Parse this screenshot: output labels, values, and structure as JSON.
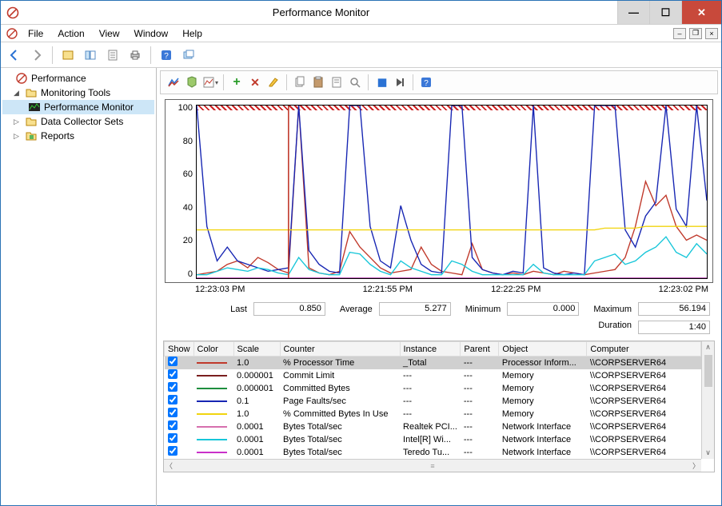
{
  "window": {
    "title": "Performance Monitor"
  },
  "menu": {
    "file": "File",
    "action": "Action",
    "view": "View",
    "window": "Window",
    "help": "Help"
  },
  "tree": {
    "root": "Performance",
    "monitoring": "Monitoring Tools",
    "perfmon": "Performance Monitor",
    "dcs": "Data Collector Sets",
    "reports": "Reports"
  },
  "chart_data": {
    "type": "line",
    "title": "",
    "ylabel": "",
    "xlabel": "",
    "ylim": [
      0,
      100
    ],
    "yticks": [
      0,
      20,
      40,
      60,
      80,
      100
    ],
    "xticks": [
      "12:23:03 PM",
      "12:21:55 PM",
      "12:22:25 PM",
      "12:23:02 PM"
    ],
    "series": [
      {
        "name": "% Processor Time",
        "color": "#c0392b",
        "values": [
          2,
          3,
          4,
          8,
          10,
          6,
          12,
          9,
          5,
          3,
          100,
          6,
          3,
          2,
          4,
          27,
          18,
          12,
          6,
          3,
          4,
          5,
          18,
          8,
          4,
          3,
          2,
          20,
          5,
          3,
          2,
          3,
          2,
          4,
          3,
          2,
          4,
          3,
          2,
          3,
          4,
          5,
          12,
          30,
          56,
          42,
          48,
          30,
          22,
          25,
          22
        ]
      },
      {
        "name": "Page Faults/sec (scaled)",
        "color": "#1726b3",
        "values": [
          100,
          30,
          10,
          18,
          10,
          8,
          6,
          4,
          5,
          6,
          100,
          16,
          8,
          4,
          3,
          100,
          100,
          30,
          10,
          6,
          42,
          22,
          8,
          4,
          3,
          100,
          100,
          12,
          5,
          3,
          2,
          4,
          3,
          100,
          6,
          3,
          2,
          3,
          2,
          100,
          100,
          100,
          28,
          18,
          36,
          44,
          100,
          40,
          30,
          100,
          45
        ]
      },
      {
        "name": "% Committed Bytes In Use",
        "color": "#f1d40f",
        "values": [
          28,
          28,
          28,
          28,
          28,
          28,
          28,
          28,
          28,
          28,
          28,
          28,
          28,
          28,
          28,
          28,
          28,
          28,
          28,
          28,
          28,
          28,
          28,
          28,
          28,
          28,
          28,
          28,
          28,
          28,
          28,
          28,
          28,
          28,
          28,
          28,
          28,
          28,
          28,
          28,
          29,
          29,
          29,
          29,
          30,
          30,
          30,
          30,
          30,
          30,
          30
        ]
      },
      {
        "name": "Bytes Total/sec Intel",
        "color": "#17c6d9",
        "values": [
          2,
          2,
          4,
          6,
          5,
          4,
          6,
          5,
          3,
          2,
          12,
          5,
          3,
          2,
          2,
          15,
          14,
          8,
          4,
          2,
          10,
          6,
          4,
          2,
          2,
          10,
          8,
          4,
          2,
          2,
          2,
          2,
          2,
          8,
          3,
          2,
          2,
          2,
          2,
          10,
          12,
          14,
          8,
          10,
          15,
          18,
          24,
          15,
          12,
          20,
          14
        ]
      },
      {
        "name": "Commit Limit",
        "color": "#7a1f1f",
        "values": [
          0,
          0,
          0,
          0,
          0,
          0,
          0,
          0,
          0,
          0,
          0,
          0,
          0,
          0,
          0,
          0,
          0,
          0,
          0,
          0,
          0,
          0,
          0,
          0,
          0,
          0,
          0,
          0,
          0,
          0,
          0,
          0,
          0,
          0,
          0,
          0,
          0,
          0,
          0,
          0,
          0,
          0,
          0,
          0,
          0,
          0,
          0,
          0,
          0,
          0,
          0
        ]
      },
      {
        "name": "Committed Bytes",
        "color": "#1e8e3e",
        "values": [
          0,
          0,
          0,
          0,
          0,
          0,
          0,
          0,
          0,
          0,
          0,
          0,
          0,
          0,
          0,
          0,
          0,
          0,
          0,
          0,
          0,
          0,
          0,
          0,
          0,
          0,
          0,
          0,
          0,
          0,
          0,
          0,
          0,
          0,
          0,
          0,
          0,
          0,
          0,
          0,
          0,
          0,
          0,
          0,
          0,
          0,
          0,
          0,
          0,
          0,
          0
        ]
      },
      {
        "name": "Bytes Total/sec Realtek",
        "color": "#d66fae",
        "values": [
          0,
          0,
          0,
          0,
          0,
          0,
          0,
          0,
          0,
          0,
          0,
          0,
          0,
          0,
          0,
          0,
          0,
          0,
          0,
          0,
          0,
          0,
          0,
          0,
          0,
          0,
          0,
          0,
          0,
          0,
          0,
          0,
          0,
          0,
          0,
          0,
          0,
          0,
          0,
          0,
          0,
          0,
          0,
          0,
          0,
          0,
          0,
          0,
          0,
          0,
          0
        ]
      },
      {
        "name": "Bytes Total/sec Teredo",
        "color": "#c930c9",
        "values": [
          0,
          0,
          0,
          0,
          0,
          0,
          0,
          0,
          0,
          0,
          0,
          0,
          0,
          0,
          0,
          0,
          0,
          0,
          0,
          0,
          0,
          0,
          0,
          0,
          0,
          0,
          0,
          0,
          0,
          0,
          0,
          0,
          0,
          0,
          0,
          0,
          0,
          0,
          0,
          0,
          0,
          0,
          0,
          0,
          0,
          0,
          0,
          0,
          0,
          0,
          0
        ]
      }
    ],
    "cursor_x_frac": 0.18
  },
  "stats": {
    "last_label": "Last",
    "last": "0.850",
    "avg_label": "Average",
    "avg": "5.277",
    "min_label": "Minimum",
    "min": "0.000",
    "max_label": "Maximum",
    "max": "56.194",
    "dur_label": "Duration",
    "dur": "1:40"
  },
  "table": {
    "headers": {
      "show": "Show",
      "color": "Color",
      "scale": "Scale",
      "counter": "Counter",
      "instance": "Instance",
      "parent": "Parent",
      "object": "Object",
      "computer": "Computer"
    },
    "rows": [
      {
        "show": true,
        "color": "#c0392b",
        "scale": "1.0",
        "counter": "% Processor Time",
        "instance": "_Total",
        "parent": "---",
        "object": "Processor Inform...",
        "computer": "\\\\CORPSERVER64",
        "selected": true
      },
      {
        "show": true,
        "color": "#7a1f1f",
        "scale": "0.000001",
        "counter": "Commit Limit",
        "instance": "---",
        "parent": "---",
        "object": "Memory",
        "computer": "\\\\CORPSERVER64"
      },
      {
        "show": true,
        "color": "#1e8e3e",
        "scale": "0.000001",
        "counter": "Committed Bytes",
        "instance": "---",
        "parent": "---",
        "object": "Memory",
        "computer": "\\\\CORPSERVER64"
      },
      {
        "show": true,
        "color": "#1726b3",
        "scale": "0.1",
        "counter": "Page Faults/sec",
        "instance": "---",
        "parent": "---",
        "object": "Memory",
        "computer": "\\\\CORPSERVER64"
      },
      {
        "show": true,
        "color": "#f1d40f",
        "scale": "1.0",
        "counter": "% Committed Bytes In Use",
        "instance": "---",
        "parent": "---",
        "object": "Memory",
        "computer": "\\\\CORPSERVER64"
      },
      {
        "show": true,
        "color": "#d66fae",
        "scale": "0.0001",
        "counter": "Bytes Total/sec",
        "instance": "Realtek PCI...",
        "parent": "---",
        "object": "Network Interface",
        "computer": "\\\\CORPSERVER64"
      },
      {
        "show": true,
        "color": "#17c6d9",
        "scale": "0.0001",
        "counter": "Bytes Total/sec",
        "instance": "Intel[R] Wi...",
        "parent": "---",
        "object": "Network Interface",
        "computer": "\\\\CORPSERVER64"
      },
      {
        "show": true,
        "color": "#c930c9",
        "scale": "0.0001",
        "counter": "Bytes Total/sec",
        "instance": "Teredo Tu...",
        "parent": "---",
        "object": "Network Interface",
        "computer": "\\\\CORPSERVER64"
      }
    ]
  }
}
